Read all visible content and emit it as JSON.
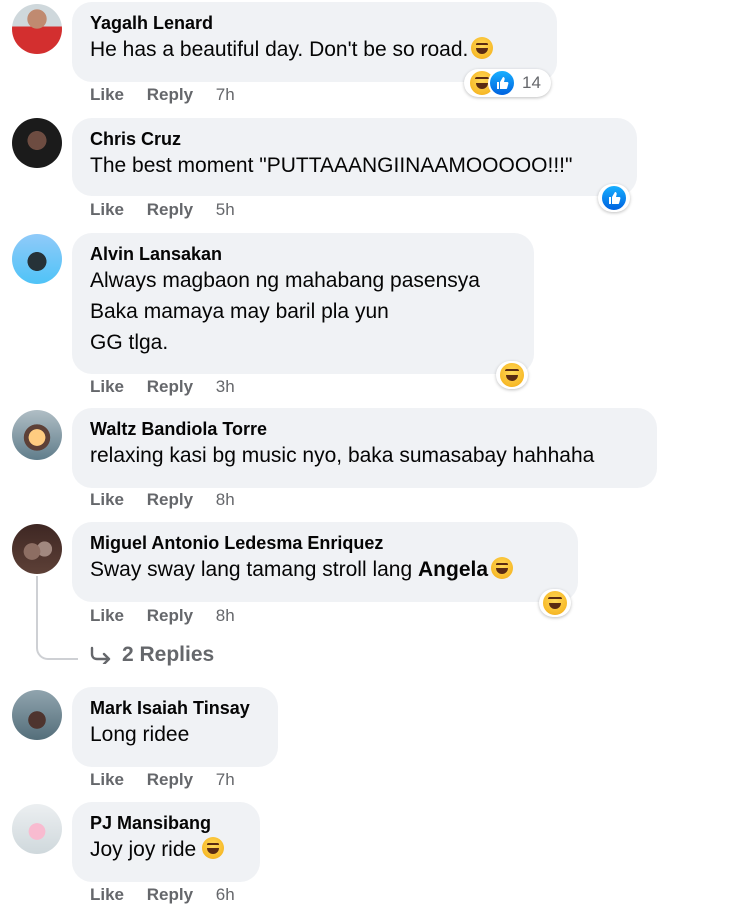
{
  "actions": {
    "like": "Like",
    "reply": "Reply"
  },
  "comments": [
    {
      "author": "Yagalh Lenard",
      "lines": [
        "He has a beautiful day. Don't be so road."
      ],
      "time": "7h",
      "reaction_count": "14"
    },
    {
      "author": "Chris Cruz",
      "lines": [
        "The best moment \"PUTTAAANGIINAAMOOOOO!!!\""
      ],
      "time": "5h"
    },
    {
      "author": "Alvin Lansakan",
      "lines": [
        "Always magbaon ng mahabang pasensya",
        "Baka mamaya may baril pla yun",
        "GG tlga."
      ],
      "time": "3h"
    },
    {
      "author": "Waltz Bandiola Torre",
      "lines": [
        "relaxing kasi bg music nyo, baka sumasabay hahhaha"
      ],
      "time": "8h"
    },
    {
      "author": "Miguel Antonio Ledesma Enriquez",
      "lines": [
        "Sway sway lang tamang stroll lang"
      ],
      "mention": "Angela",
      "time": "8h"
    },
    {
      "author": "Mark Isaiah Tinsay",
      "lines": [
        "Long ridee"
      ],
      "time": "7h"
    },
    {
      "author": "PJ Mansibang",
      "lines": [
        "Joy joy ride"
      ],
      "time": "6h"
    }
  ],
  "replies_link": "2 Replies",
  "colors": {
    "bubble": "#f0f2f5",
    "meta": "#65676b",
    "like_blue": "#1877f2",
    "haha_yellow": "#f7b928"
  }
}
